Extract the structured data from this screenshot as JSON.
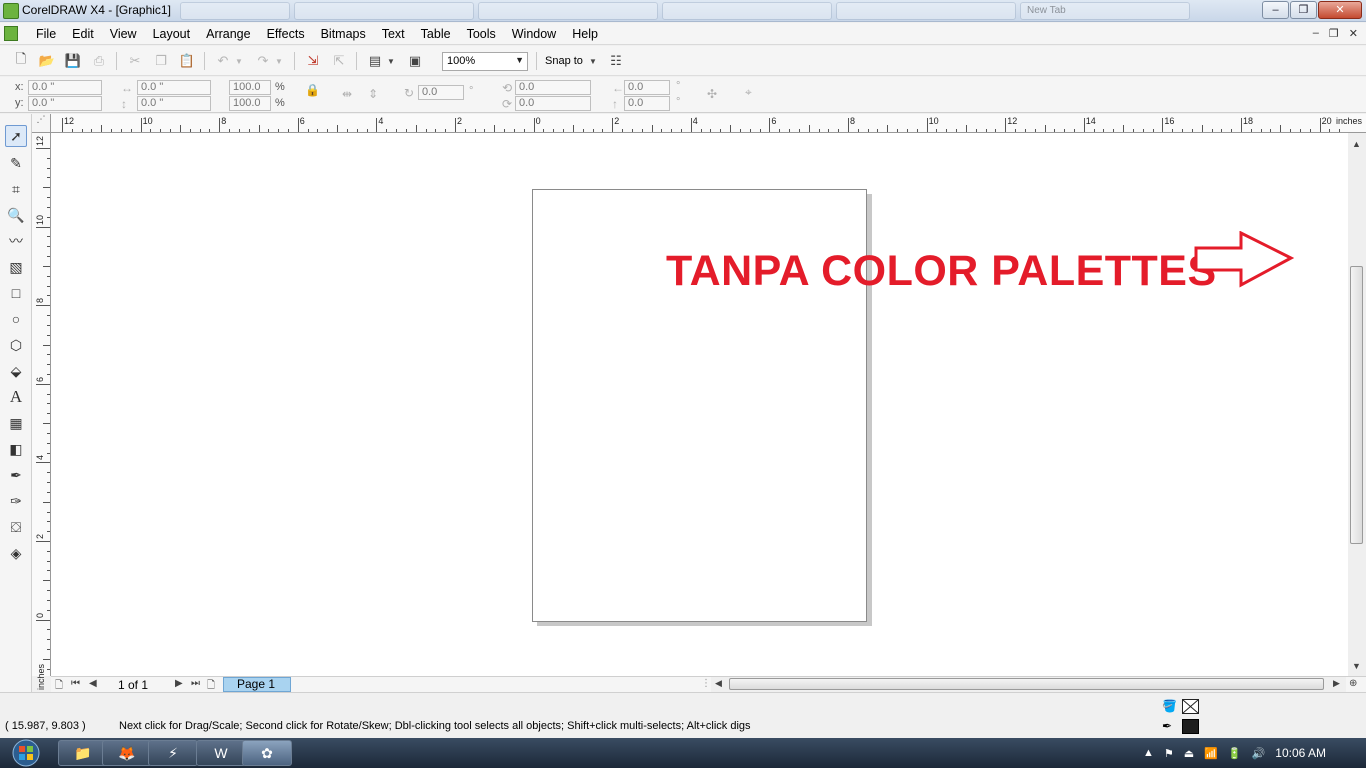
{
  "window": {
    "title": "CorelDRAW X4 - [Graphic1]",
    "background_tabs": [
      "",
      "",
      "",
      "",
      "",
      "",
      "New Tab"
    ],
    "minimize": "–",
    "maximize": "❐",
    "close": "✕"
  },
  "menubar": {
    "items": [
      "File",
      "Edit",
      "View",
      "Layout",
      "Arrange",
      "Effects",
      "Bitmaps",
      "Text",
      "Table",
      "Tools",
      "Window",
      "Help"
    ],
    "mdi_minimize": "–",
    "mdi_restore": "❐",
    "mdi_close": "✕"
  },
  "standard_toolbar": {
    "zoom_value": "100%",
    "snap_to_label": "Snap to"
  },
  "property_bar": {
    "x_label": "x:",
    "y_label": "y:",
    "x_value": "0.0 \"",
    "y_value": "0.0 \"",
    "width_value": "0.0 \"",
    "height_value": "0.0 \"",
    "scale_x": "100.0",
    "scale_y": "100.0",
    "percent": "%",
    "rotation": "0.0",
    "degree": "°",
    "skew_h": "0.0",
    "skew_v": "0.0",
    "pos_h": "0.0",
    "pos_v": "0.0"
  },
  "rulers": {
    "units": "inches",
    "h_labels": [
      "12",
      "10",
      "8",
      "6",
      "4",
      "2",
      "0",
      "2",
      "4",
      "6",
      "8",
      "10",
      "12",
      "14",
      "16",
      "18",
      "20"
    ],
    "v_labels": [
      "12",
      "10",
      "8",
      "6",
      "4",
      "2",
      "0"
    ]
  },
  "canvas": {
    "annotation_text": "TANPA COLOR PALETTES",
    "annotation_color": "#e41c2a"
  },
  "page_nav": {
    "page_count": "1 of 1",
    "page_tab": "Page 1"
  },
  "statusbar": {
    "coords": "( 15.987, 9.803 )",
    "hint": "Next click for Drag/Scale; Second click for Rotate/Skew; Dbl-clicking tool selects all objects; Shift+click multi-selects; Alt+click digs"
  },
  "taskbar": {
    "clock": "10:06 AM",
    "apps": [
      "explorer",
      "firefox",
      "winamp",
      "word",
      "coreldraw"
    ]
  },
  "colors": {
    "accent_blue": "#a9d3f0",
    "annotation_red": "#e41c2a",
    "taskbar_dark": "#1c2838"
  }
}
